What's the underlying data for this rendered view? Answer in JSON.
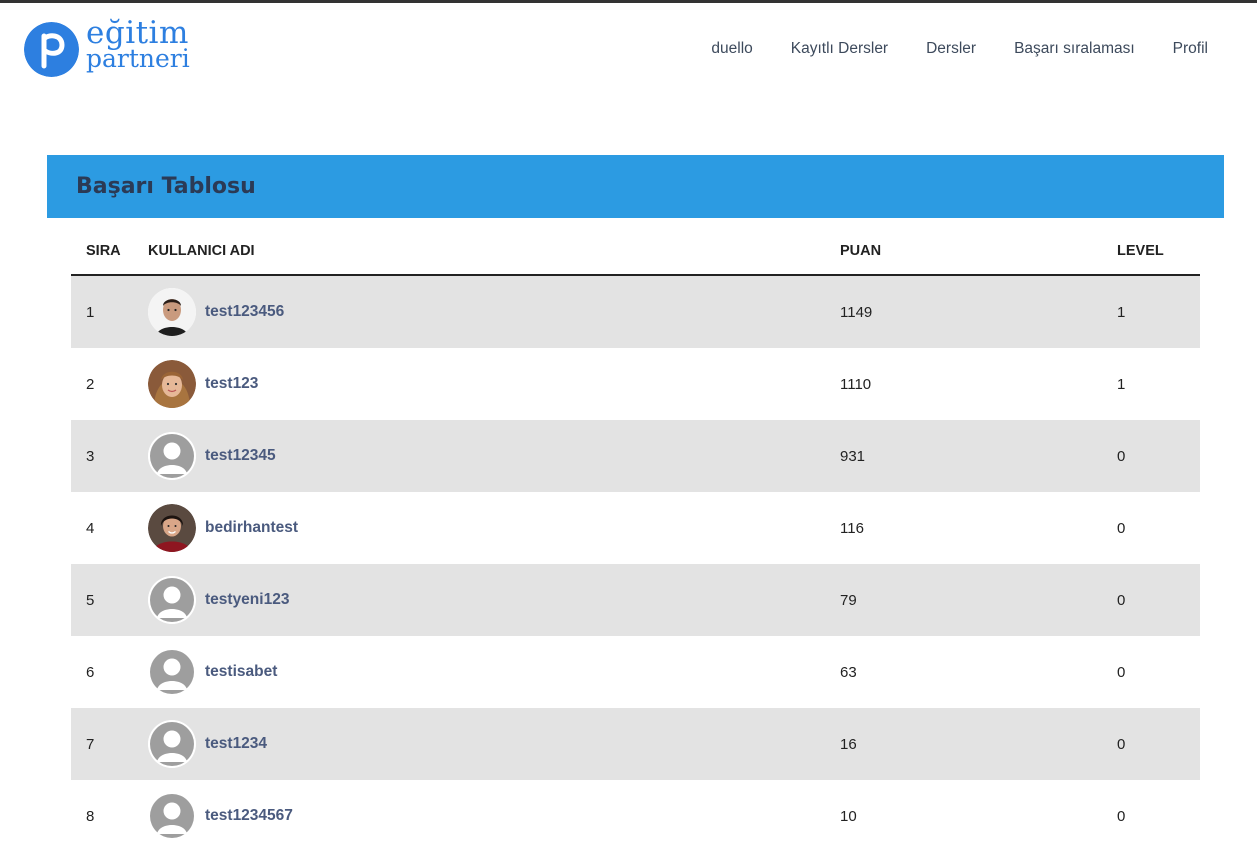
{
  "logo": {
    "line1": "eğitim",
    "line2": "partneri"
  },
  "nav": [
    {
      "label": "duello"
    },
    {
      "label": "Kayıtlı Dersler"
    },
    {
      "label": "Dersler"
    },
    {
      "label": "Başarı sıralaması"
    },
    {
      "label": "Profil"
    }
  ],
  "panel": {
    "title": "Başarı Tablosu"
  },
  "table": {
    "headers": {
      "rank": "SIRA",
      "user": "KULLANICI ADI",
      "score": "PUAN",
      "level": "LEVEL"
    },
    "rows": [
      {
        "rank": "1",
        "user": "test123456",
        "score": "1149",
        "level": "1",
        "avatar": "photo-man"
      },
      {
        "rank": "2",
        "user": "test123",
        "score": "1110",
        "level": "1",
        "avatar": "photo-woman"
      },
      {
        "rank": "3",
        "user": "test12345",
        "score": "931",
        "level": "0",
        "avatar": "default"
      },
      {
        "rank": "4",
        "user": "bedirhantest",
        "score": "116",
        "level": "0",
        "avatar": "photo-woman-red"
      },
      {
        "rank": "5",
        "user": "testyeni123",
        "score": "79",
        "level": "0",
        "avatar": "default"
      },
      {
        "rank": "6",
        "user": "testisabet",
        "score": "63",
        "level": "0",
        "avatar": "default"
      },
      {
        "rank": "7",
        "user": "test1234",
        "score": "16",
        "level": "0",
        "avatar": "default"
      },
      {
        "rank": "8",
        "user": "test1234567",
        "score": "10",
        "level": "0",
        "avatar": "default"
      }
    ]
  },
  "colors": {
    "brand": "#2d7fe0",
    "header_bar": "#2c9be2",
    "row_alt": "#e3e3e3",
    "username": "#4a5a7e"
  }
}
